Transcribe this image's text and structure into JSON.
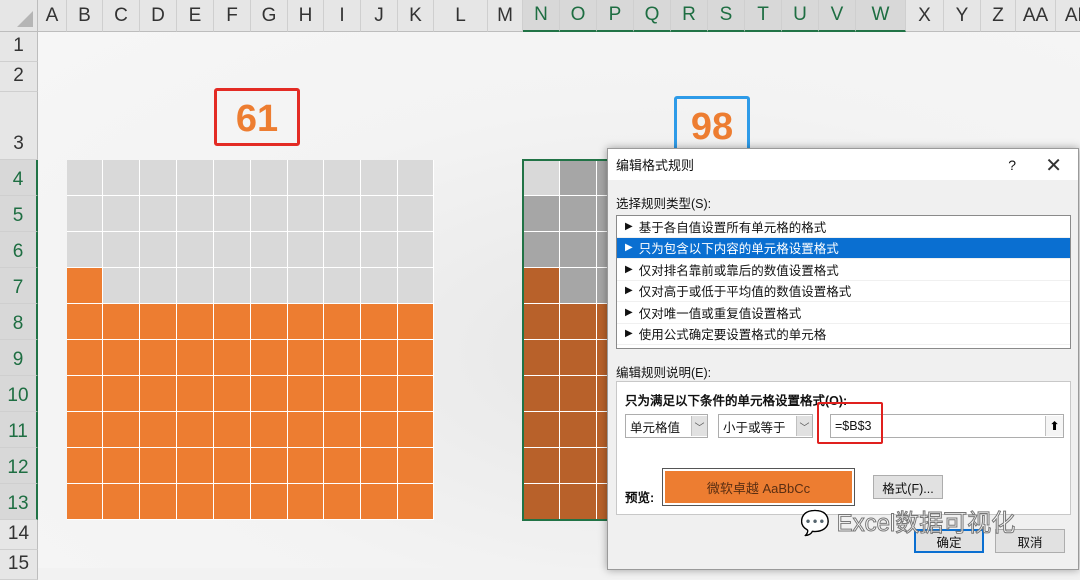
{
  "spreadsheet": {
    "columns": [
      "A",
      "B",
      "C",
      "D",
      "E",
      "F",
      "G",
      "H",
      "I",
      "J",
      "K",
      "L",
      "M",
      "N",
      "O",
      "P",
      "Q",
      "R",
      "S",
      "T",
      "U",
      "V",
      "W",
      "X",
      "Y",
      "Z",
      "AA",
      "AB"
    ],
    "rows": [
      "1",
      "2",
      "3",
      "4",
      "5",
      "6",
      "7",
      "8",
      "9",
      "10",
      "11",
      "12",
      "13",
      "14",
      "15"
    ],
    "left_grid": {
      "value": "61",
      "filled_cells": 61,
      "fill_color": "#ed7d31",
      "empty_color": "#d9d9d9",
      "box_color": "#e32b24"
    },
    "right_grid": {
      "value": "98",
      "filled_cells": 61,
      "fill_color": "#b8612a",
      "empty_color": "#a6a6a6",
      "active_cell_color": "#d9d9d9",
      "box_color": "#2e9be8"
    }
  },
  "dialog": {
    "title": "编辑格式规则",
    "help": "?",
    "close": "✕",
    "rule_type_label": "选择规则类型(S):",
    "rule_types": [
      {
        "label": "基于各自值设置所有单元格的格式",
        "selected": false
      },
      {
        "label": "只为包含以下内容的单元格设置格式",
        "selected": true
      },
      {
        "label": "仅对排名靠前或靠后的数值设置格式",
        "selected": false
      },
      {
        "label": "仅对高于或低于平均值的数值设置格式",
        "selected": false
      },
      {
        "label": "仅对唯一值或重复值设置格式",
        "selected": false
      },
      {
        "label": "使用公式确定要设置格式的单元格",
        "selected": false
      }
    ],
    "description_label": "编辑规则说明(E):",
    "condition_heading": "只为满足以下条件的单元格设置格式(O):",
    "condition_type": "单元格值",
    "operator": "小于或等于",
    "formula": "=$B$3",
    "preview_label": "预览:",
    "preview_text": "微软卓越  AaBbCc",
    "preview_color": "#ed7d31",
    "format_button": "格式(F)...",
    "ok_button": "确定",
    "cancel_button": "取消"
  },
  "watermark": "Excel数据可视化"
}
